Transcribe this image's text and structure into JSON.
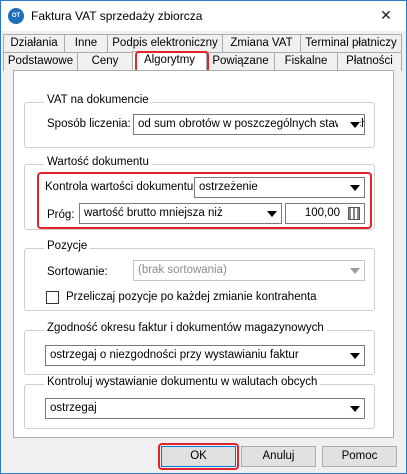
{
  "window": {
    "title": "Faktura VAT sprzedaży zbiorcza",
    "app_icon_text": "OT",
    "close_glyph": "✕"
  },
  "tabs_top": [
    "Działania",
    "Inne",
    "Podpis elektroniczny",
    "Zmiana VAT",
    "Terminal płatniczy"
  ],
  "tabs_bottom": [
    "Podstawowe",
    "Ceny",
    "Algorytmy",
    "Powiązane",
    "Fiskalne",
    "Płatności"
  ],
  "active_tab": "Algorytmy",
  "vat_group": {
    "title": "VAT na dokumencie",
    "label": "Sposób liczenia:",
    "value": "od sum obrotów w poszczególnych stawkach"
  },
  "value_group": {
    "title": "Wartość dokumentu",
    "control_label": "Kontrola wartości dokumentu:",
    "control_value": "ostrzeżenie",
    "threshold_label": "Próg:",
    "threshold_type": "wartość brutto mniejsza niż",
    "threshold_amount": "100,00"
  },
  "positions_group": {
    "title": "Pozycje",
    "sort_label": "Sortowanie:",
    "sort_value": "(brak sortowania)",
    "recalc_label": "Przeliczaj pozycje po każdej zmianie kontrahenta",
    "recalc_checked": false
  },
  "period_group": {
    "title": "Zgodność okresu faktur i dokumentów magazynowych",
    "value": "ostrzegaj o niezgodności przy wystawianiu faktur"
  },
  "currency_group": {
    "title": "Kontroluj wystawianie dokumentu w walutach obcych",
    "value": "ostrzegaj"
  },
  "buttons": {
    "ok": "OK",
    "cancel": "Anuluj",
    "help": "Pomoc"
  },
  "colors": {
    "highlight": "#e0232d",
    "window_border": "#2b78c5",
    "default_button": "#0078d7"
  }
}
